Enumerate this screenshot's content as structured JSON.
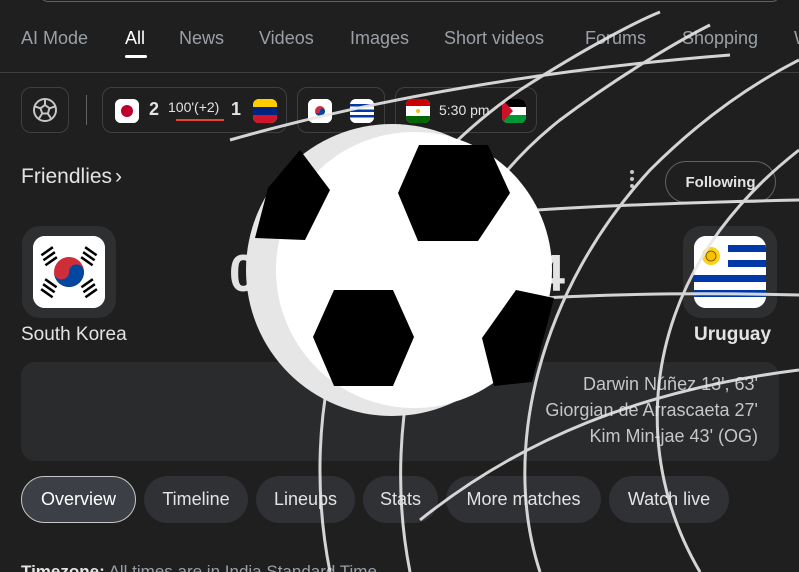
{
  "tabs": [
    {
      "label": "AI Mode"
    },
    {
      "label": "All"
    },
    {
      "label": "News"
    },
    {
      "label": "Videos"
    },
    {
      "label": "Images"
    },
    {
      "label": "Short videos"
    },
    {
      "label": "Forums"
    },
    {
      "label": "Shopping"
    },
    {
      "label": "W"
    }
  ],
  "active_tab": "All",
  "match_strip": {
    "match1": {
      "home_score": "2",
      "minute": "100'(+2)",
      "away_score": "1"
    },
    "match3": {
      "time": "5:30 pm"
    }
  },
  "competition": {
    "title": "Friendlies",
    "chevron": "›",
    "follow_label": "Following"
  },
  "match": {
    "home_team": "South Korea",
    "away_team": "Uruguay",
    "home_score_partial": "0",
    "away_score_partial": "4"
  },
  "scorers": [
    "Darwin Núñez 13', 63'",
    "Giorgian de Arrascaeta 27'",
    "Kim Min-jae 43' (OG)"
  ],
  "pills": [
    {
      "label": "Overview"
    },
    {
      "label": "Timeline"
    },
    {
      "label": "Lineups"
    },
    {
      "label": "Stats"
    },
    {
      "label": "More matches"
    },
    {
      "label": "Watch live"
    }
  ],
  "timezone": {
    "label": "Timezone:",
    "text": "All times are in India Standard Time"
  },
  "icons": {
    "soccer_ball": "soccer-ball-icon",
    "kebab": "more-vert-icon"
  },
  "colors": {
    "background": "#1f1f1f",
    "card": "#2a2b2d",
    "pill": "#303134",
    "accent_underline": "#ea4335"
  }
}
